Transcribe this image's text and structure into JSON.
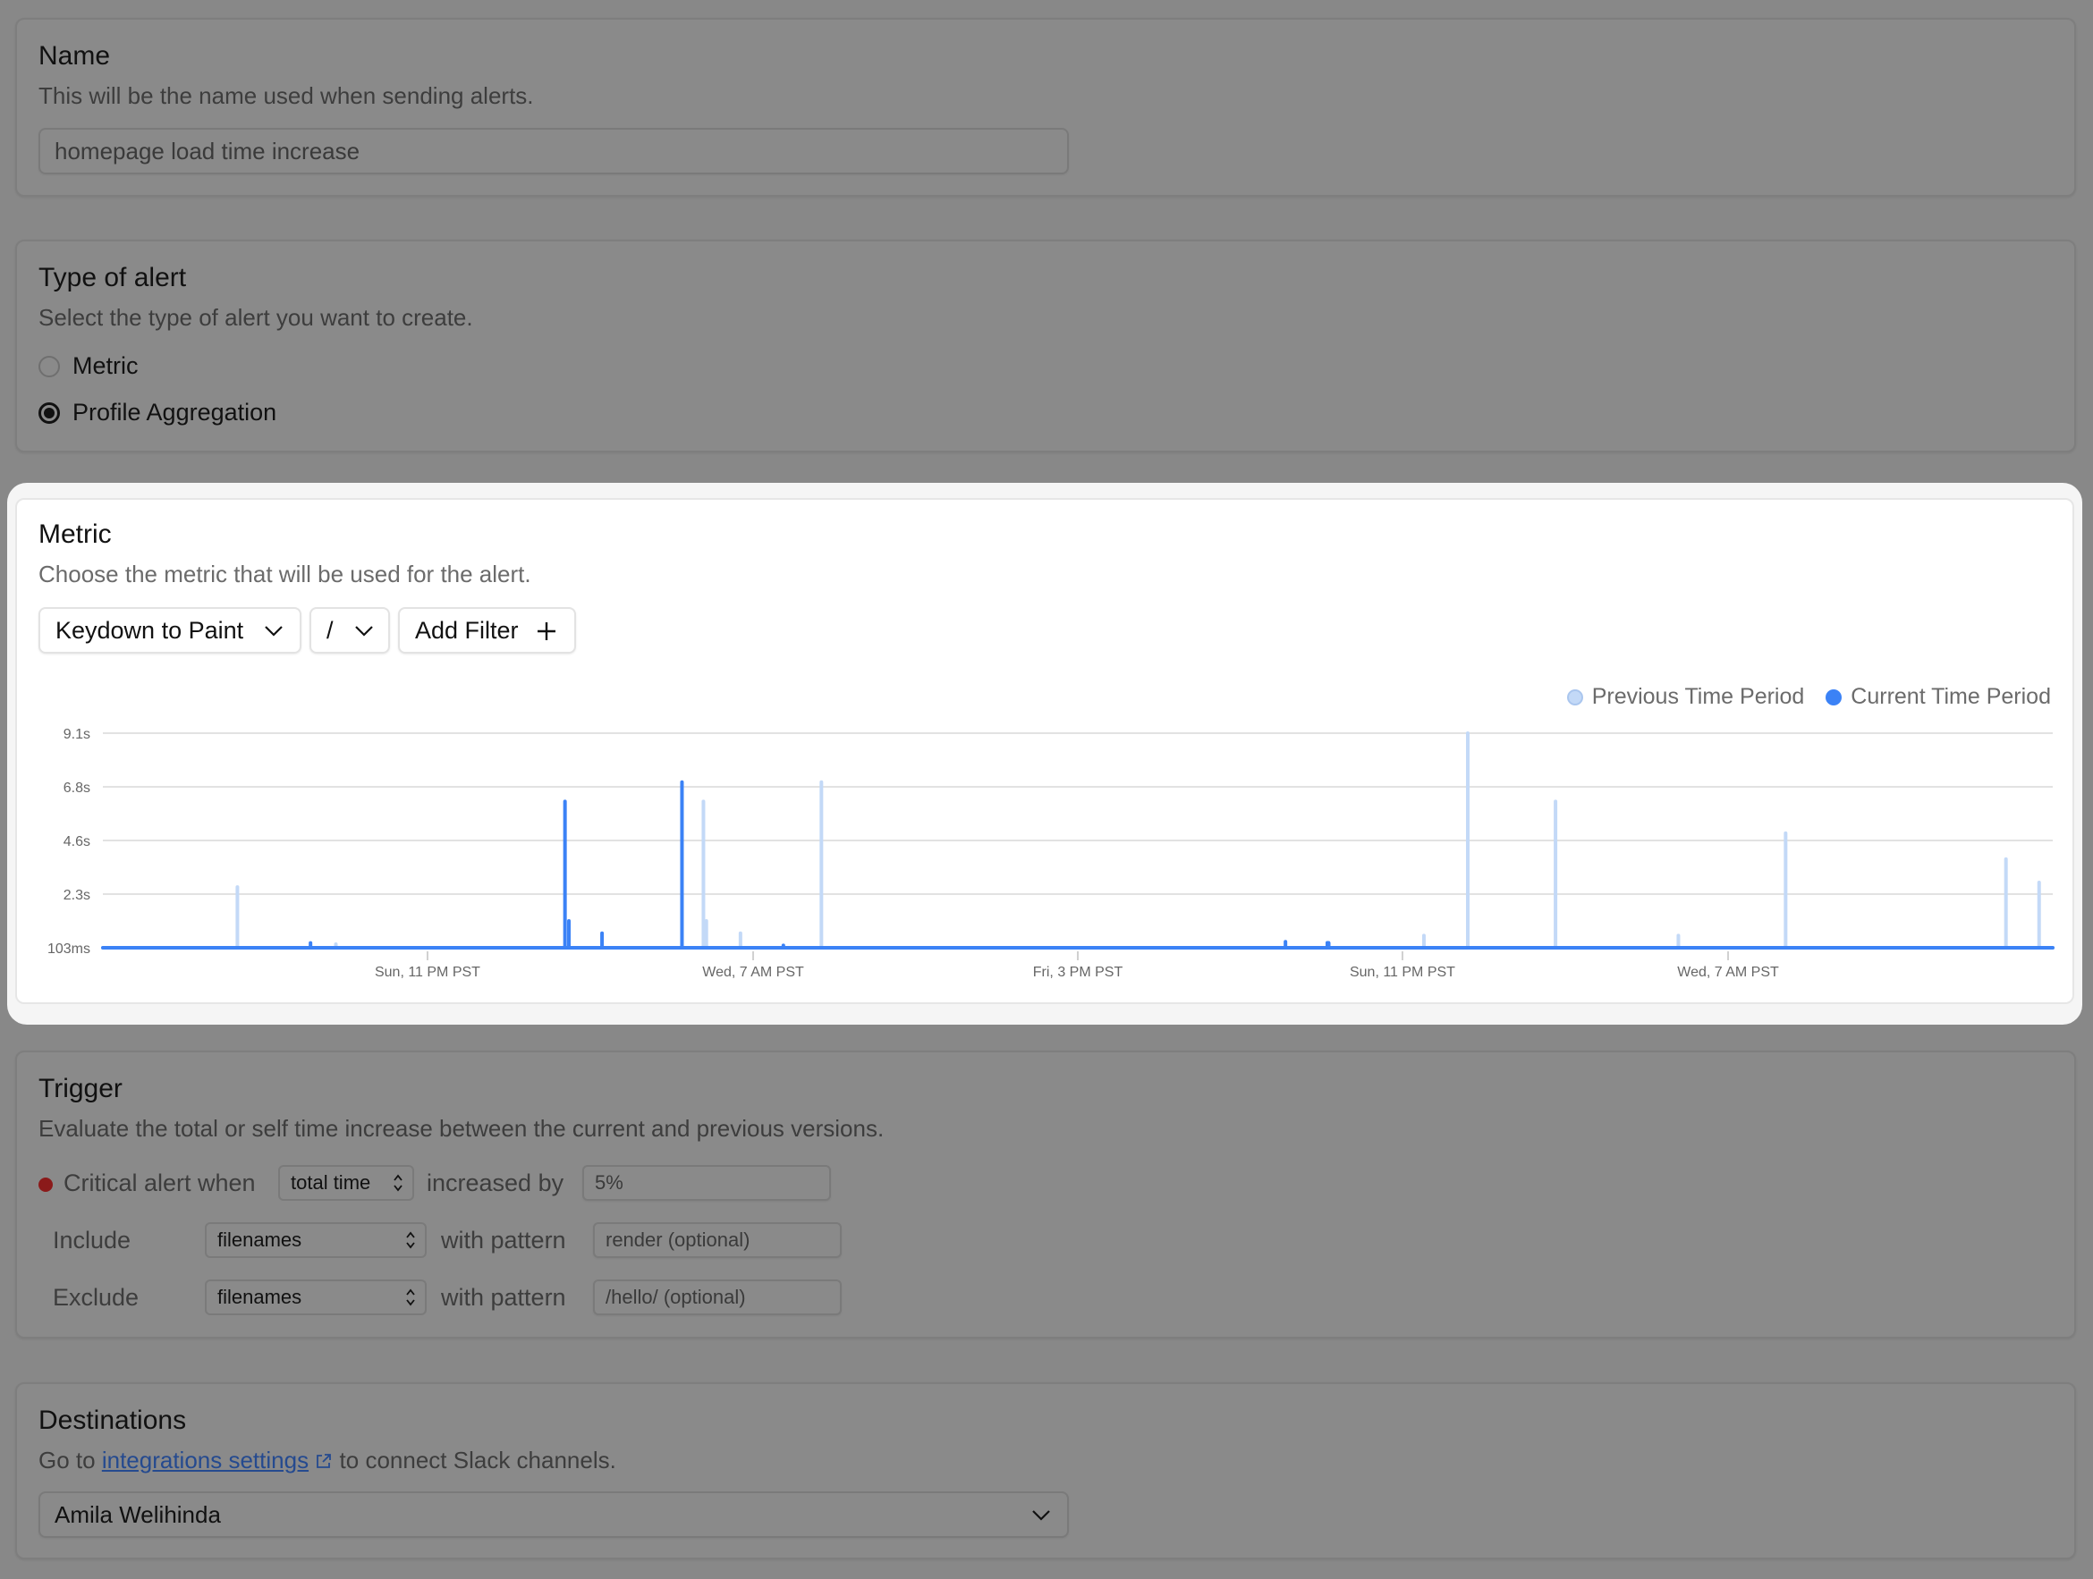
{
  "name_section": {
    "title": "Name",
    "description": "This will be the name used when sending alerts.",
    "input_value": "homepage load time increase"
  },
  "type_section": {
    "title": "Type of alert",
    "description": "Select the type of alert you want to create.",
    "options": [
      {
        "label": "Metric",
        "checked": false
      },
      {
        "label": "Profile Aggregation",
        "checked": true
      }
    ]
  },
  "metric_section": {
    "title": "Metric",
    "description": "Choose the metric that will be used for the alert.",
    "metric_select": "Keydown to Paint",
    "path_select": "/",
    "add_filter_label": "Add Filter",
    "legend": [
      {
        "label": "Previous Time Period",
        "color": "#c3d9f7"
      },
      {
        "label": "Current Time Period",
        "color": "#3b82f6"
      }
    ]
  },
  "chart_data": {
    "type": "line",
    "title": "",
    "xlabel": "",
    "ylabel": "",
    "y_ticks": [
      "103ms",
      "2.3s",
      "4.6s",
      "6.8s",
      "9.1s"
    ],
    "y_tick_values": [
      0.103,
      2.3,
      4.6,
      6.8,
      9.1
    ],
    "ylim": [
      0.103,
      9.1
    ],
    "x_ticks": [
      {
        "label": "Sun, 11 PM PST",
        "t": 0.1665
      },
      {
        "label": "Wed, 7 AM PST",
        "t": 0.3335
      },
      {
        "label": "Fri, 3 PM PST",
        "t": 0.5
      },
      {
        "label": "Sun, 11 PM PST",
        "t": 0.6665
      },
      {
        "label": "Wed, 7 AM PST",
        "t": 0.8335
      }
    ],
    "xlim_fraction": [
      0,
      1
    ],
    "grid": true,
    "legend_position": "top-right",
    "baseline_value": 0.103,
    "series": [
      {
        "name": "Previous Time Period",
        "color": "#c3d9f7",
        "spikes": [
          {
            "t": 0.069,
            "value": 2.6
          },
          {
            "t": 0.1195,
            "value": 0.25
          },
          {
            "t": 0.308,
            "value": 6.2
          },
          {
            "t": 0.3095,
            "value": 1.2
          },
          {
            "t": 0.327,
            "value": 0.7
          },
          {
            "t": 0.3685,
            "value": 7.0
          },
          {
            "t": 0.6775,
            "value": 0.6
          },
          {
            "t": 0.7,
            "value": 9.1
          },
          {
            "t": 0.745,
            "value": 6.2
          },
          {
            "t": 0.808,
            "value": 0.6
          },
          {
            "t": 0.863,
            "value": 4.9
          },
          {
            "t": 0.976,
            "value": 3.8
          },
          {
            "t": 0.993,
            "value": 2.8
          }
        ]
      },
      {
        "name": "Current Time Period",
        "color": "#3b82f6",
        "spikes": [
          {
            "t": 0.1065,
            "value": 0.3
          },
          {
            "t": 0.237,
            "value": 6.2
          },
          {
            "t": 0.239,
            "value": 1.2
          },
          {
            "t": 0.256,
            "value": 0.7
          },
          {
            "t": 0.297,
            "value": 7.0
          },
          {
            "t": 0.349,
            "value": 0.2
          },
          {
            "t": 0.6065,
            "value": 0.35
          },
          {
            "t": 0.6285,
            "value": 0.3
          },
          {
            "t": 0.6285,
            "value": 0.3
          },
          {
            "t": 0.6285,
            "value": 0.3
          },
          {
            "t": 0.628,
            "value": 0.3
          },
          {
            "t": 0.6285,
            "value": 0.3
          },
          {
            "t": 0.628,
            "value": 0.3
          },
          {
            "t": 0.6285,
            "value": 0.3
          },
          {
            "t": 0.6285,
            "value": 0.3
          },
          {
            "t": 0.6285,
            "value": 0.3
          },
          {
            "t": 0.6285,
            "value": 0.3
          },
          {
            "t": 0.6285,
            "value": 0.3
          },
          {
            "t": 0.6285,
            "value": 0.3
          },
          {
            "t": 0.628,
            "value": 0.3
          },
          {
            "t": 0.6285,
            "value": 0.3
          },
          {
            "t": 0.6285,
            "value": 0.3
          },
          {
            "t": 0.6285,
            "value": 0.3
          },
          {
            "t": 0.6285,
            "value": 0.3
          },
          {
            "t": 0.6285,
            "value": 0.3
          },
          {
            "t": 0.6285,
            "value": 0.3
          },
          {
            "t": 0.6285,
            "value": 0.3
          },
          {
            "t": 0.628,
            "value": 0.3
          },
          {
            "t": 0.6285,
            "value": 0.3
          },
          {
            "t": 0.6285,
            "value": 0.3
          },
          {
            "t": 0.6285,
            "value": 0.3
          },
          {
            "t": 0.6285,
            "value": 0.3
          },
          {
            "t": 0.6285,
            "value": 0.3
          },
          {
            "t": 0.6285,
            "value": 0.3
          },
          {
            "t": 0.6285,
            "value": 0.3
          },
          {
            "t": 0.6285,
            "value": 0.3
          },
          {
            "t": 0.6285,
            "value": 0.3
          },
          {
            "t": 0.6285,
            "value": 0.3
          },
          {
            "t": 0.6285,
            "value": 0.3
          },
          {
            "t": 0.6285,
            "value": 0.3
          },
          {
            "t": 0.6285,
            "value": 0.3
          },
          {
            "t": 0.6285,
            "value": 0.3
          },
          {
            "t": 0.6285,
            "value": 0.3
          },
          {
            "t": 0.6285,
            "value": 0.3
          },
          {
            "t": 0.6285,
            "value": 0.3
          },
          {
            "t": 0.6285,
            "value": 0.3
          },
          {
            "t": 0.6285,
            "value": 0.3
          },
          {
            "t": 0.6285,
            "value": 0.3
          },
          {
            "t": 0.6285,
            "value": 0.3
          },
          {
            "t": 0.6285,
            "value": 0.3
          },
          {
            "t": 0.6285,
            "value": 0.3
          },
          {
            "t": 0.6285,
            "value": 0.3
          },
          {
            "t": 0.6285,
            "value": 0.3
          },
          {
            "t": 0.6285,
            "value": 0.3
          }
        ]
      }
    ]
  },
  "trigger_section": {
    "title": "Trigger",
    "description": "Evaluate the total or self time increase between the current and previous versions.",
    "critical_label": "Critical alert when",
    "critical_dot_color": "#8b1a1a",
    "time_select": "total time",
    "increased_by_label": "increased by",
    "increased_by_value": "5%",
    "include_label": "Include",
    "include_select": "filenames",
    "include_with_pattern": "with pattern",
    "include_placeholder": "render (optional)",
    "exclude_label": "Exclude",
    "exclude_select": "filenames",
    "exclude_with_pattern": "with pattern",
    "exclude_placeholder": "/hello/ (optional)"
  },
  "destinations_section": {
    "title": "Destinations",
    "desc_prefix": "Go to",
    "link_text": "integrations settings",
    "desc_suffix": "to connect Slack channels.",
    "selected": "Amila Welihinda"
  }
}
